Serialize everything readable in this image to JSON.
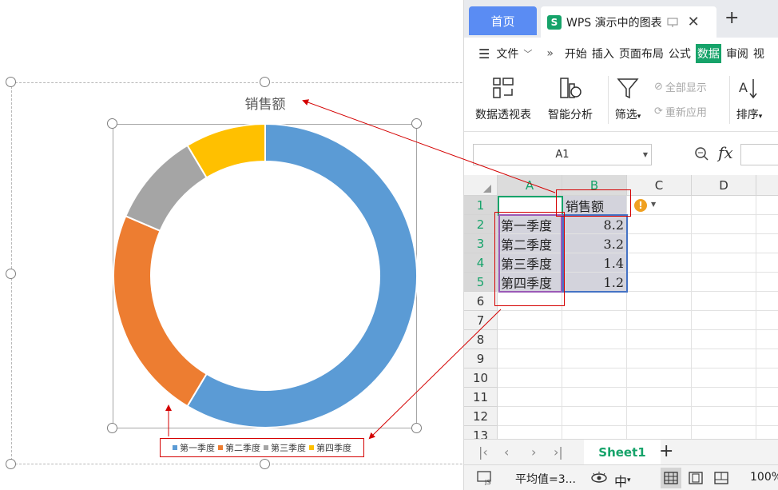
{
  "slide": {
    "chart_title": "销售额",
    "legend": [
      {
        "label": "第一季度",
        "color": "#5b9bd5"
      },
      {
        "label": "第二季度",
        "color": "#ed7d31"
      },
      {
        "label": "第三季度",
        "color": "#a5a5a5"
      },
      {
        "label": "第四季度",
        "color": "#ffc000"
      }
    ]
  },
  "chart_data": {
    "type": "pie",
    "variant": "doughnut",
    "title": "销售额",
    "categories": [
      "第一季度",
      "第二季度",
      "第三季度",
      "第四季度"
    ],
    "values": [
      8.2,
      3.2,
      1.4,
      1.2
    ],
    "colors": [
      "#5b9bd5",
      "#ed7d31",
      "#a5a5a5",
      "#ffc000"
    ],
    "legend_position": "bottom"
  },
  "window": {
    "home_tab": "首页",
    "doc_icon": "S",
    "doc_tab": "WPS 演示中的图表",
    "add_tab": "+"
  },
  "menu": {
    "file": "文件",
    "more": "»",
    "items": [
      "开始",
      "插入",
      "页面布局",
      "公式",
      "数据",
      "审阅",
      "视"
    ],
    "active": "数据"
  },
  "ribbon": {
    "pivot": "数据透视表",
    "smart_analysis": "智能分析",
    "filter": "筛选",
    "show_all": "全部显示",
    "reapply": "重新应用",
    "sort": "排序"
  },
  "formula_bar": {
    "name_box": "A1",
    "fx": "fx"
  },
  "sheet": {
    "columns": [
      "A",
      "B",
      "C",
      "D"
    ],
    "rows": [
      "1",
      "2",
      "3",
      "4",
      "5",
      "6",
      "7",
      "8",
      "9",
      "10",
      "11",
      "12",
      "13"
    ],
    "header_cell": "销售额",
    "labels": [
      "第一季度",
      "第二季度",
      "第三季度",
      "第四季度"
    ],
    "values": [
      "8.2",
      "3.2",
      "1.4",
      "1.2"
    ],
    "warning_icon": "!"
  },
  "sheet_tabs": {
    "active": "Sheet1",
    "add": "+"
  },
  "status": {
    "average": "平均值=3...",
    "zoom": "100%"
  }
}
